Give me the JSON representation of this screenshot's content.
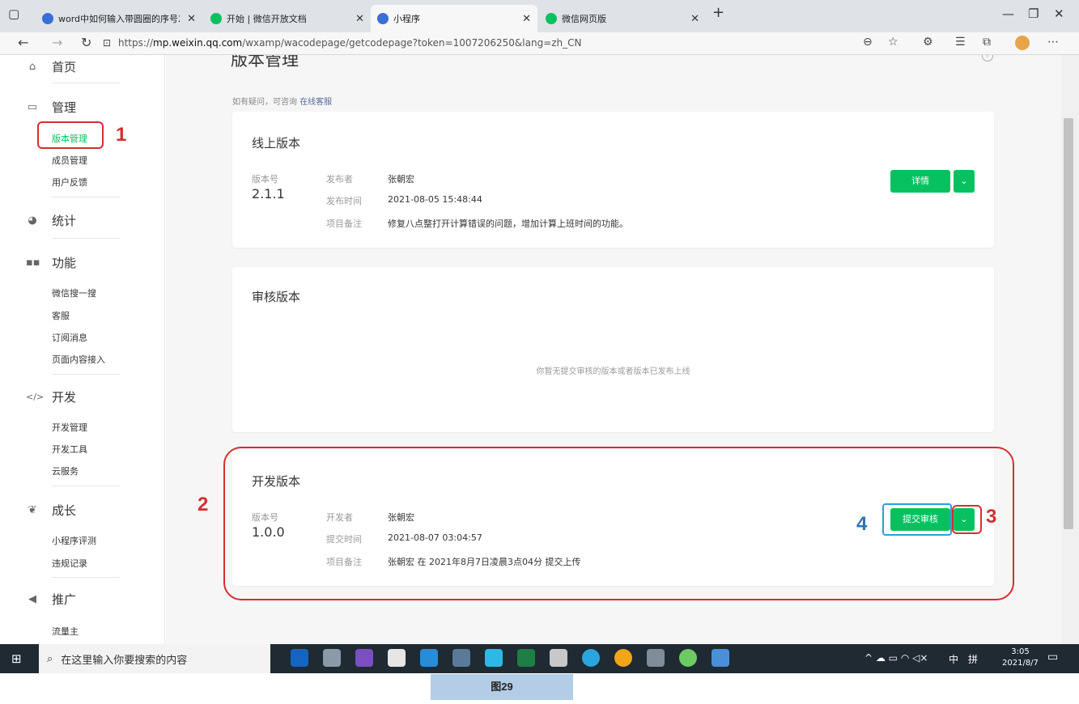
{
  "browser": {
    "tabs": [
      {
        "label": "word中如何输入带圆圈的序号2",
        "icon_color": "#3a6fd8"
      },
      {
        "label": "开始 | 微信开放文档",
        "icon_color": "#07c160"
      },
      {
        "label": "小程序",
        "icon_color": "#3a6fd8"
      },
      {
        "label": "微信网页版",
        "icon_color": "#07c160"
      }
    ],
    "new_tab": "+",
    "url_prefix": "https://",
    "url_host": "mp.weixin.qq.com",
    "url_path": "/wxamp/wacodepage/getcodepage?token=1007206250&lang=zh_CN"
  },
  "sidebar": {
    "home": "首页",
    "manage": "管理",
    "manage_items": [
      "版本管理",
      "成员管理",
      "用户反馈"
    ],
    "stats": "统计",
    "features": "功能",
    "feature_items": [
      "微信搜一搜",
      "客服",
      "订阅消息",
      "页面内容接入"
    ],
    "dev": "开发",
    "dev_items": [
      "开发管理",
      "开发工具",
      "云服务"
    ],
    "growth": "成长",
    "growth_items": [
      "小程序评测",
      "违规记录"
    ],
    "promo": "推广",
    "promo_items": [
      "流量主"
    ]
  },
  "main": {
    "page_title": "版本管理",
    "tip_text": "如有疑问，可咨询 ",
    "tip_link": "在线客服",
    "online": {
      "title": "线上版本",
      "version_label": "版本号",
      "version": "2.1.1",
      "publisher_label": "发布者",
      "publisher": "张朝宏",
      "time_label": "发布时间",
      "time": "2021-08-05 15:48:44",
      "note_label": "项目备注",
      "note": "修复八点整打开计算错误的问题，增加计算上班时间的功能。",
      "details_button": "详情"
    },
    "review": {
      "title": "审核版本",
      "empty": "你暂无提交审核的版本或者版本已发布上线"
    },
    "dev": {
      "title": "开发版本",
      "version_label": "版本号",
      "version": "1.0.0",
      "developer_label": "开发者",
      "developer": "张朝宏",
      "time_label": "提交时间",
      "time": "2021-08-07 03:04:57",
      "note_label": "项目备注",
      "note": "张朝宏 在 2021年8月7日凌晨3点04分 提交上传",
      "submit_button": "提交审核"
    }
  },
  "annotations": {
    "n1": "1",
    "n2": "2",
    "n3": "3",
    "n4": "4",
    "red": "#d32f2f",
    "blue": "#2e75b6"
  },
  "taskbar": {
    "search_placeholder": "在这里输入你要搜索的内容",
    "ime1": "中",
    "ime2": "拼",
    "time": "3:05",
    "date": "2021/8/7"
  },
  "caption": "图29"
}
